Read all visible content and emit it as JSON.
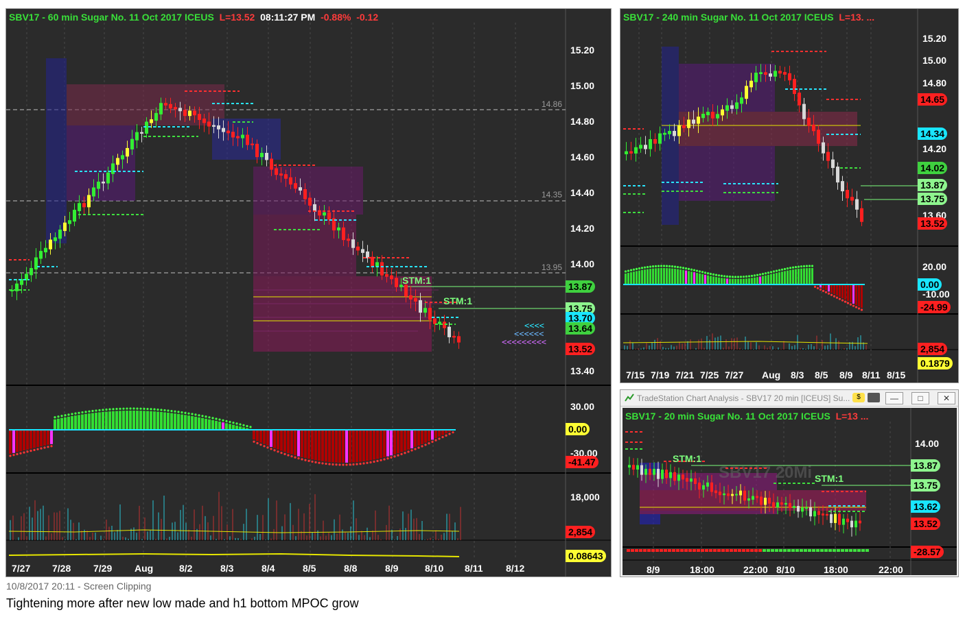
{
  "panel_main": {
    "title_symbol": "SBV17 - 60 min  Sugar No. 11 Oct 2017  ICEUS",
    "title_last": "L=13.52",
    "title_time": "08:11:27 PM",
    "title_pct": "-0.88%",
    "title_chg": "-0.12",
    "price_axis": [
      "15.20",
      "15.00",
      "14.80",
      "14.60",
      "14.40",
      "14.20",
      "14.00",
      "13.40"
    ],
    "level_lines": [
      "14.86",
      "14.35",
      "13.95"
    ],
    "tags": [
      {
        "label": "13.87",
        "color": "#3fd13f"
      },
      {
        "label": "13.75",
        "color": "#8ef58e"
      },
      {
        "label": "13.70",
        "color": "#19e6ff"
      },
      {
        "label": "13.64",
        "color": "#3fd13f"
      },
      {
        "label": "13.52",
        "color": "#ff2020"
      }
    ],
    "stm_labels": [
      "STM:1",
      "STM:1"
    ],
    "osc_axis": [
      "30.00",
      "-30.00"
    ],
    "osc_tags": [
      {
        "label": "0.00",
        "color": "#ffff33"
      },
      {
        "label": "-41.47",
        "color": "#ff2020"
      }
    ],
    "vol_axis": [
      "18,000"
    ],
    "vol_tags": [
      {
        "label": "2,854",
        "color": "#ff2020"
      }
    ],
    "ind_tags": [
      {
        "label": "0.08643",
        "color": "#ffff33"
      }
    ],
    "dates": [
      "7/27",
      "7/28",
      "7/29",
      "Aug",
      "8/2",
      "8/3",
      "8/4",
      "8/5",
      "8/8",
      "8/9",
      "8/10",
      "8/11",
      "8/12"
    ]
  },
  "panel_240": {
    "title_symbol": "SBV17 - 240 min  Sugar No. 11 Oct 2017  ICEUS",
    "title_last": "L=13. ...",
    "price_axis": [
      "15.20",
      "15.00",
      "14.80",
      "14.20",
      "13.60"
    ],
    "tags": [
      {
        "label": "14.65",
        "color": "#ff2020"
      },
      {
        "label": "14.34",
        "color": "#19e6ff"
      },
      {
        "label": "14.02",
        "color": "#3fd13f"
      },
      {
        "label": "13.87",
        "color": "#8ef58e"
      },
      {
        "label": "13.75",
        "color": "#8ef58e"
      },
      {
        "label": "13.52",
        "color": "#ff2020"
      }
    ],
    "osc_axis": [
      "20.00",
      "-10.00"
    ],
    "osc_tags": [
      {
        "label": "0.00",
        "color": "#19e6ff"
      },
      {
        "label": "-24.99",
        "color": "#ff2020"
      }
    ],
    "vol_tags": [
      {
        "label": "2,854",
        "color": "#ff2020"
      },
      {
        "label": "0.1879",
        "color": "#ffff33"
      }
    ],
    "dates": [
      "7/15",
      "7/19",
      "7/21",
      "7/25",
      "7/27",
      "Aug",
      "8/3",
      "8/5",
      "8/9",
      "8/11",
      "8/15"
    ]
  },
  "panel_20": {
    "window_title": "TradeStation Chart Analysis - SBV17 20 min [ICEUS] Su...",
    "title_symbol": "SBV17 - 20 min  Sugar No. 11 Oct 2017  ICEUS",
    "title_last": "L=13 ...",
    "price_axis": [
      "14.00"
    ],
    "tags": [
      {
        "label": "13.87",
        "color": "#8ef58e"
      },
      {
        "label": "13.75",
        "color": "#8ef58e"
      },
      {
        "label": "13.62",
        "color": "#19e6ff"
      },
      {
        "label": "13.52",
        "color": "#ff2020"
      }
    ],
    "stm_labels": [
      "STM:1",
      "STM:1"
    ],
    "osc_tags": [
      {
        "label": "-28.57",
        "color": "#ff2020"
      }
    ],
    "dates": [
      "8/9",
      "18:00",
      "22:00",
      "8/10",
      "18:00",
      "22:00"
    ],
    "watermark": "SBV17 20Mi"
  },
  "caption": {
    "clip_line": "10/8/2017 20:11 - Screen Clipping",
    "note": "Tightening more after new low made and h1 bottom MPOC grow"
  }
}
